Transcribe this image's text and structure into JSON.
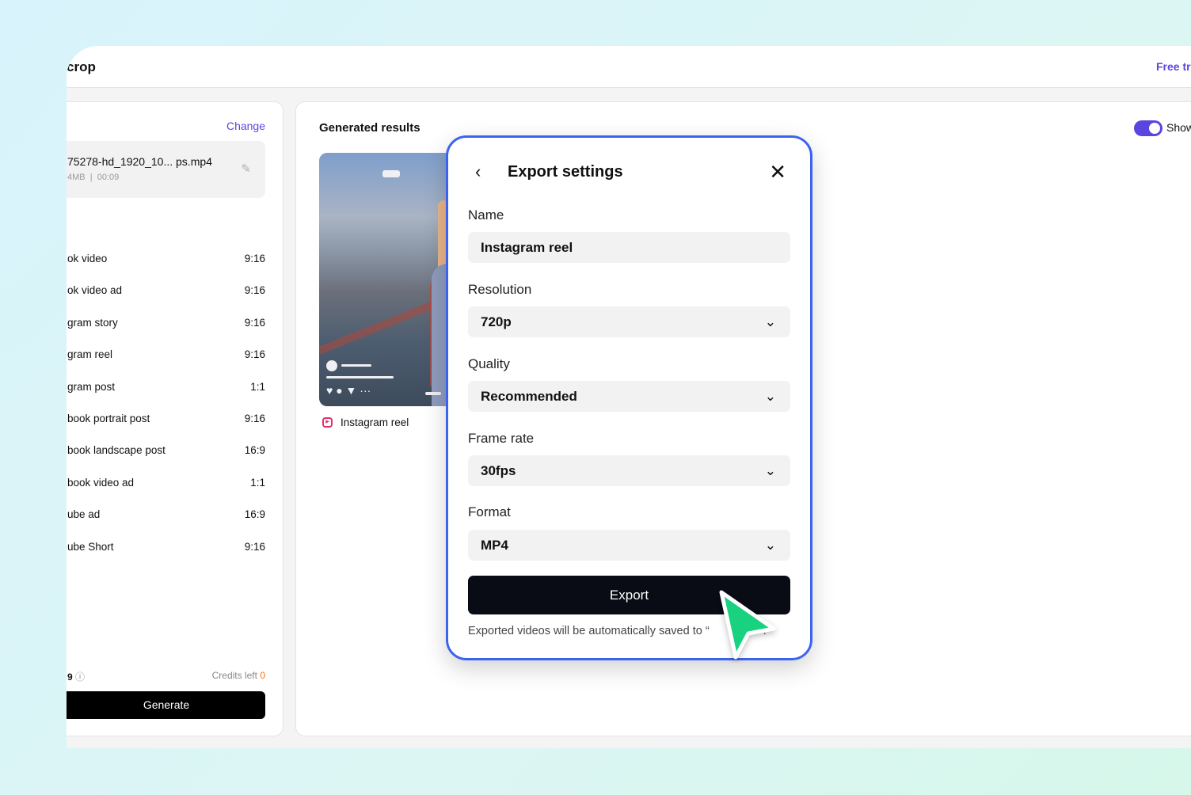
{
  "header": {
    "title": "crop",
    "free_trial": "Free tr"
  },
  "left": {
    "change": "Change",
    "file_name": "75278-hd_1920_10...  ps.mp4",
    "file_size": "4MB",
    "file_duration": "00:09",
    "presets": [
      {
        "label": "ok video",
        "ratio": "9:16"
      },
      {
        "label": "ok video ad",
        "ratio": "9:16"
      },
      {
        "label": "gram story",
        "ratio": "9:16"
      },
      {
        "label": "gram reel",
        "ratio": "9:16"
      },
      {
        "label": "gram post",
        "ratio": "1:1"
      },
      {
        "label": "book portrait post",
        "ratio": "9:16"
      },
      {
        "label": "book landscape post",
        "ratio": "16:9"
      },
      {
        "label": "book video ad",
        "ratio": "1:1"
      },
      {
        "label": "ube ad",
        "ratio": "16:9"
      },
      {
        "label": "ube Short",
        "ratio": "9:16"
      }
    ],
    "cost": "9",
    "credits_label": "Credits left",
    "credits": "0",
    "generate": "Generate"
  },
  "main": {
    "title": "Generated results",
    "toggle_label": "Show",
    "toggle_on": true,
    "result_label": "Instagram reel"
  },
  "modal": {
    "title": "Export settings",
    "name_label": "Name",
    "name_value": "Instagram reel",
    "resolution_label": "Resolution",
    "resolution_value": "720p",
    "quality_label": "Quality",
    "quality_value": "Recommended",
    "framerate_label": "Frame rate",
    "framerate_value": "30fps",
    "format_label": "Format",
    "format_value": "MP4",
    "export": "Export",
    "note": "Exported videos will be automatically saved to “",
    "note_end": ".”"
  },
  "colors": {
    "accent": "#5b45e0",
    "modal_border": "#3b63f0",
    "cursor": "#19d27f"
  }
}
